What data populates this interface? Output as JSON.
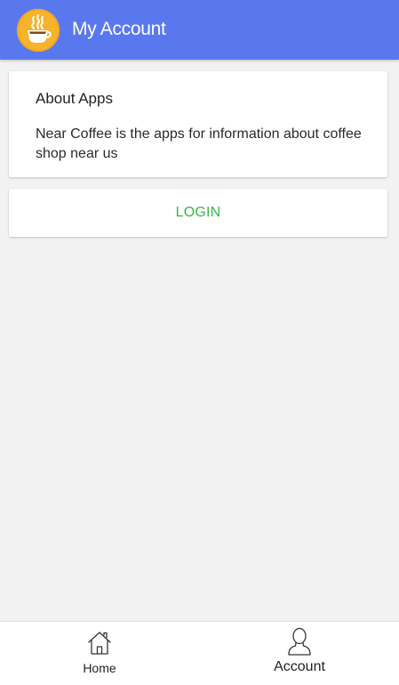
{
  "header": {
    "title": "My Account",
    "logo_icon": "coffee-cup-icon",
    "background_color": "#5a78ee"
  },
  "about": {
    "title": "About Apps",
    "text": "Near Coffee is the apps for information about coffee shop near us"
  },
  "login": {
    "label": "LOGIN",
    "color": "#38b549"
  },
  "tab_bar": {
    "items": [
      {
        "label": "Home",
        "icon": "home-icon",
        "active": false
      },
      {
        "label": "Account",
        "icon": "user-icon",
        "active": true
      }
    ]
  }
}
